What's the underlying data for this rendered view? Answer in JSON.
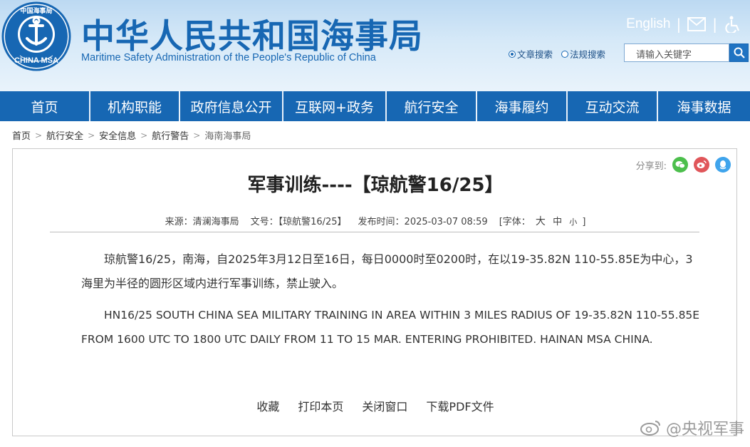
{
  "header": {
    "title": "中华人民共和国海事局",
    "subtitle": "Maritime Safety Administration of the People's Republic of China",
    "logo_text_top": "中国海事局",
    "logo_text_bottom": "CHINA MSA",
    "english_link": "English",
    "separator": "|",
    "icons": {
      "mail": "mail-icon",
      "accessibility": "accessibility-icon",
      "search": "search-icon"
    },
    "search_options": [
      {
        "label": "文章搜索",
        "selected": true
      },
      {
        "label": "法规搜索",
        "selected": false
      }
    ],
    "search_placeholder": "请输入关键字"
  },
  "nav": {
    "items": [
      {
        "label": "首页"
      },
      {
        "label": "机构职能"
      },
      {
        "label": "政府信息公开"
      },
      {
        "label": "互联网+政务"
      },
      {
        "label": "航行安全"
      },
      {
        "label": "海事履约"
      },
      {
        "label": "互动交流"
      },
      {
        "label": "海事数据"
      }
    ]
  },
  "breadcrumb": [
    "首页",
    "航行安全",
    "安全信息",
    "航行警告",
    "海南海事局"
  ],
  "article": {
    "share_label": "分享到:",
    "share_icons": [
      "wechat-icon",
      "weibo-icon",
      "qq-icon"
    ],
    "title": "军事训练----【琼航警16/25】",
    "meta": {
      "source": "来源：清澜海事局",
      "doc_no": "文号：【琼航警16/25】",
      "published": "发布时间：2025-03-07 08:59",
      "font_label": "[字体：",
      "font_large": "大",
      "font_medium": "中",
      "font_small": "小",
      "font_close": "]"
    },
    "para_cn": "琼航警16/25，南海，自2025年3月12日至16日，每日0000时至0200时，在以19-35.82N 110-55.85E为中心，3海里为半径的圆形区域内进行军事训练，禁止驶入。",
    "para_en": "HN16/25 SOUTH CHINA SEA MILITARY TRAINING IN AREA WITHIN 3 MILES RADIUS OF 19-35.82N 110-55.85E FROM 1600 UTC TO 1800 UTC DAILY FROM 11 TO 15 MAR. ENTERING PROHIBITED. HAINAN MSA CHINA.",
    "actions": [
      "收藏",
      "打印本页",
      "关闭窗口",
      "下载PDF文件"
    ]
  },
  "watermark": "@央视军事",
  "colors": {
    "brand_blue": "#1767b3",
    "nav_bg": "#1767b3",
    "wechat": "#4cbf4c",
    "weibo": "#e0565a",
    "qq": "#3fa4ec"
  }
}
